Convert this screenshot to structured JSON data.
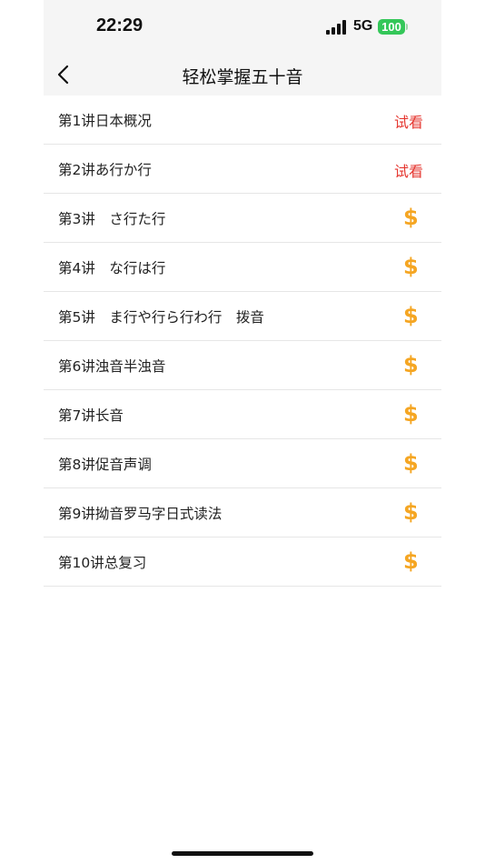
{
  "status_bar": {
    "time": "22:29",
    "network": "5G",
    "battery": "100",
    "battery_color": "#34c759"
  },
  "nav": {
    "title": "轻松掌握五十音",
    "back_icon": "chevron-left-icon"
  },
  "colors": {
    "preview": "#e5362f",
    "paid": "#f5a623"
  },
  "lessons": [
    {
      "title": "第1讲日本概况",
      "badge": "preview",
      "badge_text": "试看"
    },
    {
      "title": "第2讲あ行か行",
      "badge": "preview",
      "badge_text": "试看"
    },
    {
      "title": "第3讲　さ行た行",
      "badge": "paid",
      "icon": "dollar-icon",
      "symbol": "$"
    },
    {
      "title": "第4讲　な行は行",
      "badge": "paid",
      "icon": "dollar-icon",
      "symbol": "$"
    },
    {
      "title": "第5讲　ま行や行ら行わ行　拨音",
      "badge": "paid",
      "icon": "dollar-icon",
      "symbol": "$"
    },
    {
      "title": "第6讲浊音半浊音",
      "badge": "paid",
      "icon": "dollar-icon",
      "symbol": "$"
    },
    {
      "title": "第7讲长音",
      "badge": "paid",
      "icon": "dollar-icon",
      "symbol": "$"
    },
    {
      "title": "第8讲促音声调",
      "badge": "paid",
      "icon": "dollar-icon",
      "symbol": "$"
    },
    {
      "title": "第9讲拗音罗马字日式读法",
      "badge": "paid",
      "icon": "dollar-icon",
      "symbol": "$"
    },
    {
      "title": "第10讲总复习",
      "badge": "paid",
      "icon": "dollar-icon",
      "symbol": "$"
    }
  ]
}
